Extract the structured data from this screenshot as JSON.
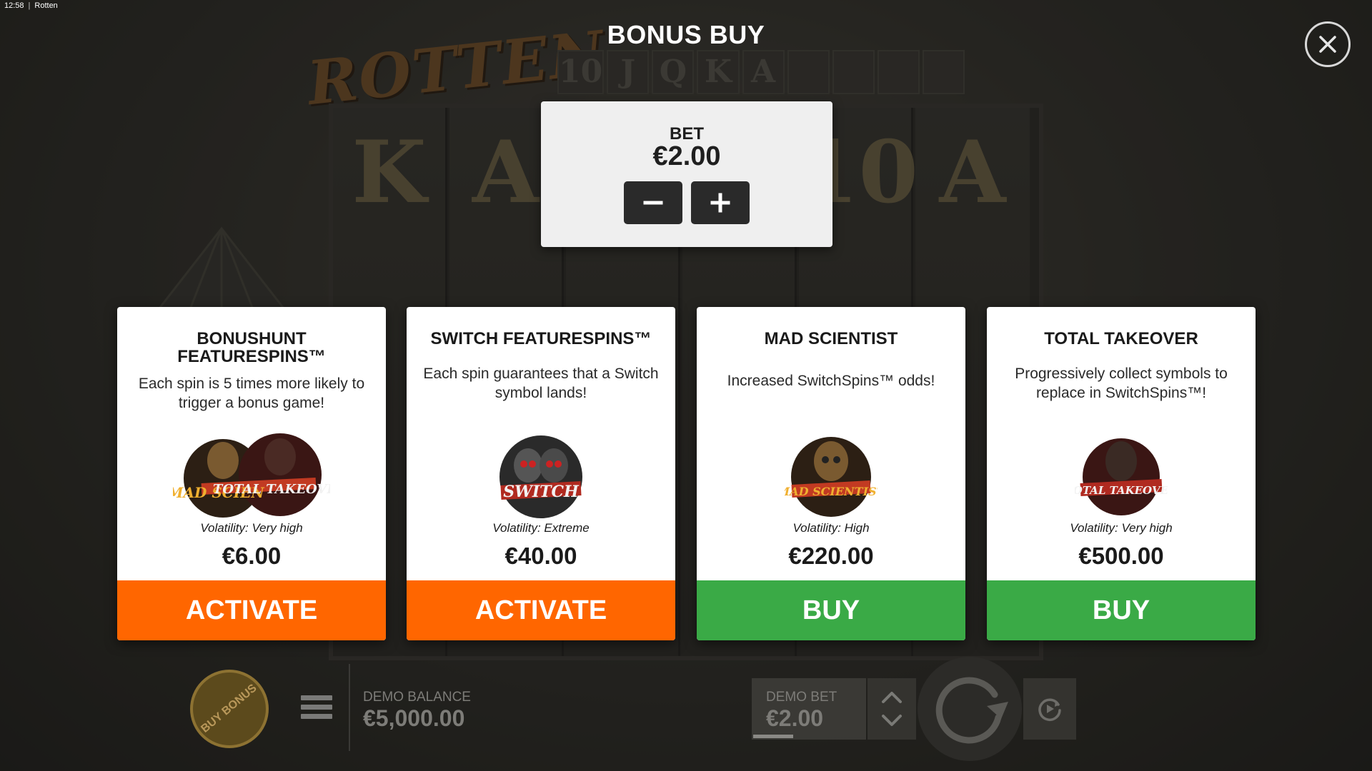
{
  "window": {
    "clock": "12:58",
    "tab_title": "Rotten"
  },
  "game": {
    "logo_text": "ROTTEN",
    "top_row_symbols": [
      "10",
      "J",
      "Q",
      "K",
      "A",
      "",
      "",
      "",
      ""
    ],
    "reel_letters": [
      "K",
      "A",
      "",
      "",
      "10",
      "A"
    ]
  },
  "modal": {
    "title": "BONUS BUY",
    "close_icon": "close-icon",
    "bet": {
      "label": "BET",
      "value": "€2.00",
      "decrease_icon": "minus-icon",
      "increase_icon": "plus-icon"
    },
    "cards": [
      {
        "title": "BONUSHUNT FEATURESPINS™",
        "description": "Each spin is 5 times more likely to trigger a bonus game!",
        "art_text_1": "MAD SCIEN",
        "art_text_2": "TOTAL TAKEOVER",
        "volatility": "Volatility: Very high",
        "price": "€6.00",
        "action": "ACTIVATE",
        "action_color": "#ff6600"
      },
      {
        "title": "SWITCH FEATURESPINS™",
        "description": "Each spin guarantees that a Switch symbol lands!",
        "art_text_1": "SWITCH",
        "volatility": "Volatility: Extreme",
        "price": "€40.00",
        "action": "ACTIVATE",
        "action_color": "#ff6600"
      },
      {
        "title": "MAD SCIENTIST",
        "description": "Increased SwitchSpins™ odds!",
        "art_text_1": "MAD SCIENTIST",
        "volatility": "Volatility: High",
        "price": "€220.00",
        "action": "BUY",
        "action_color": "#3aaa46"
      },
      {
        "title": "TOTAL TAKEOVER",
        "description": "Progressively collect symbols to replace in SwitchSpins™!",
        "art_text_1": "TOTAL TAKEOVER",
        "volatility": "Volatility: Very high",
        "price": "€500.00",
        "action": "BUY",
        "action_color": "#3aaa46"
      }
    ]
  },
  "hud": {
    "buy_bonus_label": "BUY BONUS",
    "menu_icon": "menu-icon",
    "balance_label": "DEMO BALANCE",
    "balance_value": "€5,000.00",
    "bet_label": "DEMO BET",
    "bet_value": "€2.00",
    "spin_icon": "spin-icon",
    "autoplay_icon": "autoplay-icon"
  },
  "colors": {
    "activate": "#ff6600",
    "buy": "#3aaa46"
  }
}
